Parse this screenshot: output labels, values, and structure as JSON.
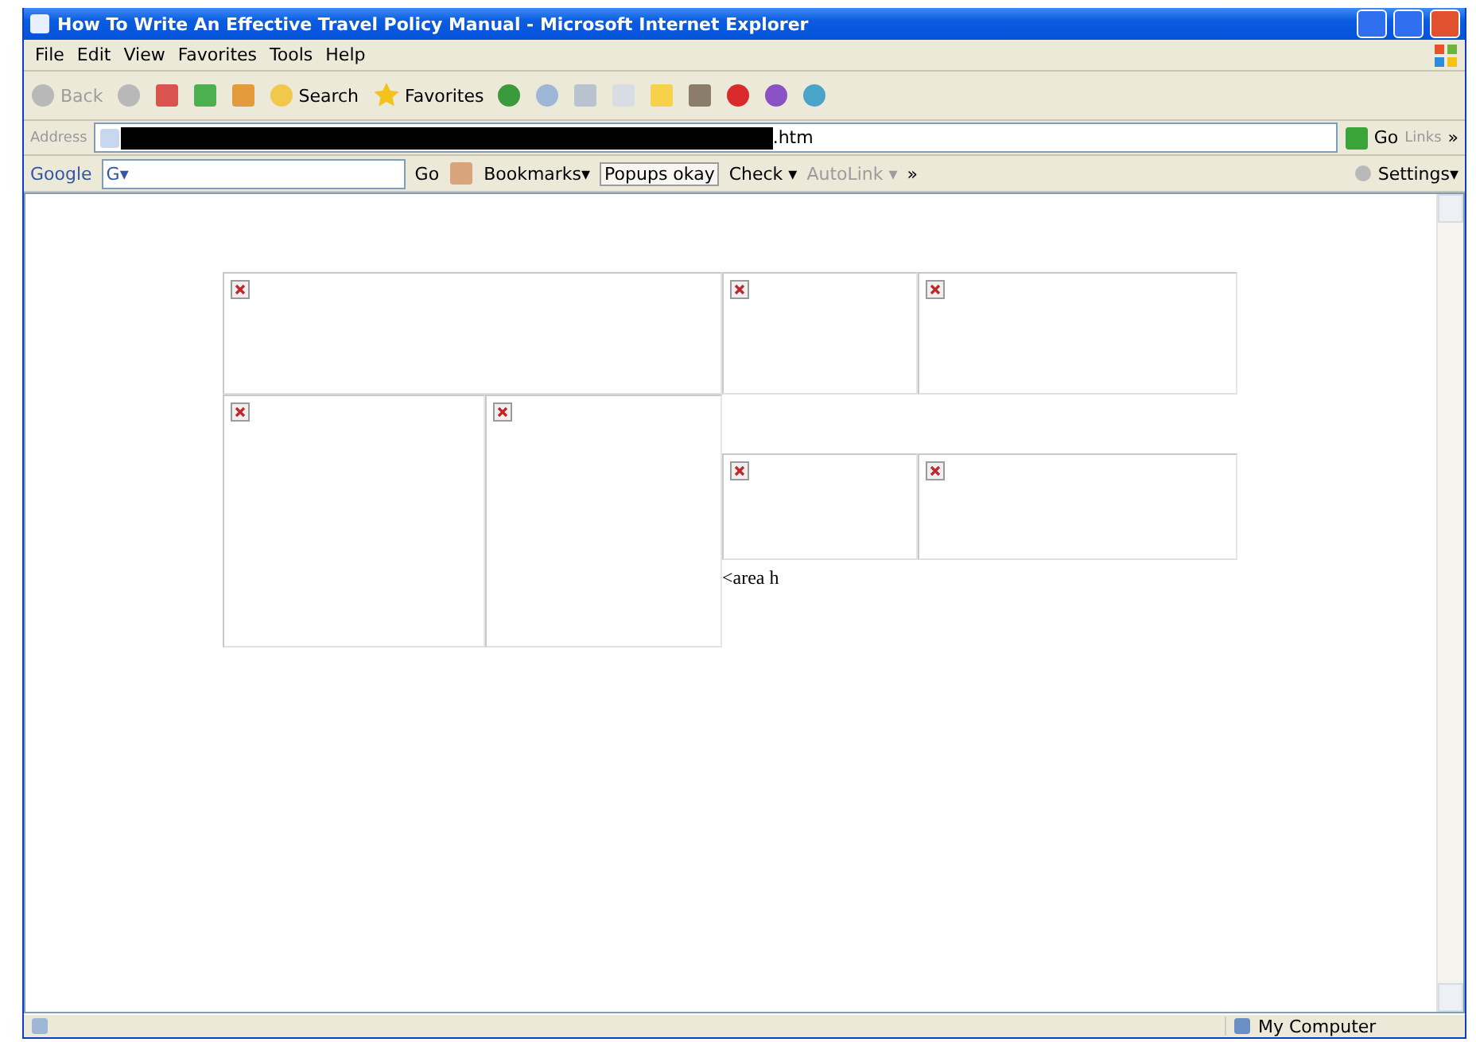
{
  "window": {
    "title": "How To Write An Effective Travel Policy Manual - Microsoft Internet Explorer"
  },
  "menu": [
    "File",
    "Edit",
    "View",
    "Favorites",
    "Tools",
    "Help"
  ],
  "toolbar": {
    "back": {
      "label": "Back",
      "disabled": true
    },
    "search": {
      "label": "Search"
    },
    "favorites": {
      "label": "Favorites"
    }
  },
  "address": {
    "label": "Address",
    "value": ".htm",
    "go": "Go",
    "links": "Links",
    "more": "»"
  },
  "google_bar": {
    "logo": "Google",
    "g_menu": "G▾",
    "go": "Go",
    "bookmarks": "Bookmarks▾",
    "popups": "Popups okay",
    "check": "Check ▾",
    "autolink": {
      "label": "AutoLink ▾",
      "disabled": true
    },
    "more": "»",
    "settings": "Settings▾"
  },
  "page": {
    "images": [
      {
        "kind": "broken"
      },
      {
        "kind": "broken"
      },
      {
        "kind": "broken"
      },
      {
        "kind": "broken"
      },
      {
        "kind": "broken"
      },
      {
        "kind": "broken"
      },
      {
        "kind": "broken"
      }
    ],
    "text": "<area h"
  },
  "status_bar": {
    "zone": "My Computer"
  }
}
